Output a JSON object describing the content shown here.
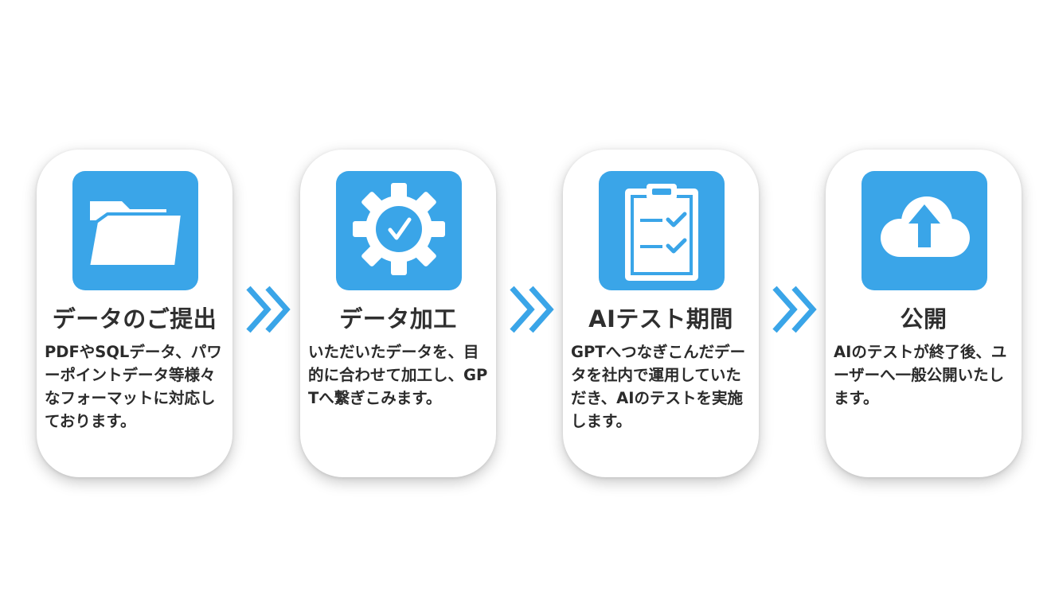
{
  "steps": [
    {
      "title": "データのご提出",
      "description": "PDFやSQLデータ、パワーポイントデータ等様々なフォーマットに対応しております。",
      "icon": "folder-icon"
    },
    {
      "title": "データ加工",
      "description": "いただいたデータを、目的に合わせて加工し、GPTへ繋ぎこみます。",
      "icon": "gear-check-icon"
    },
    {
      "title": "AIテスト期間",
      "description": "GPTへつなぎこんだデータを社内で運用していただき、AIのテストを実施します。",
      "icon": "clipboard-checklist-icon"
    },
    {
      "title": "公開",
      "description": "AIのテストが終了後、ユーザーへ一般公開いたします。",
      "icon": "cloud-upload-icon"
    }
  ],
  "colors": {
    "accent": "#3aa5e8",
    "text": "#2b2b2b",
    "card_background": "#ffffff"
  },
  "connector_icon": "double-chevron-right-icon"
}
